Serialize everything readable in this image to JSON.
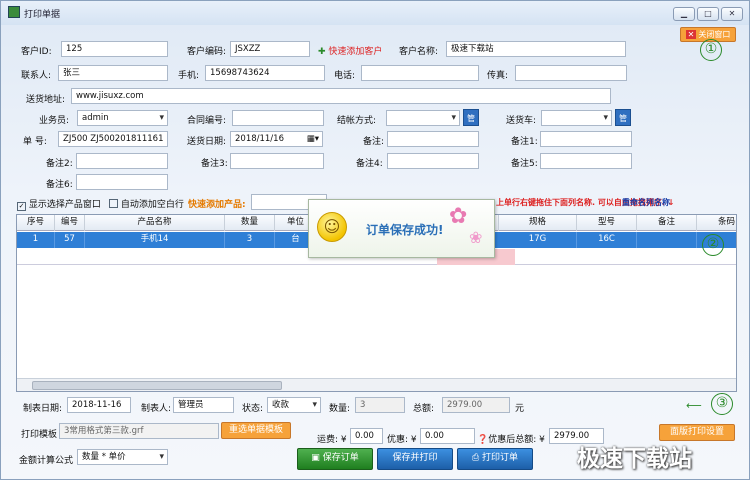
{
  "window": {
    "title": "打印单据",
    "min": "▁",
    "max": "□",
    "close": "✕"
  },
  "close_window_btn": "关闭窗口",
  "badges": [
    "①",
    "②",
    "③"
  ],
  "form": {
    "customer_id_label": "客户ID:",
    "customer_id": "125",
    "customer_code_label": "客户编码:",
    "customer_code": "JSXZZ",
    "quick_add_customer": "快速添加客户",
    "customer_name_label": "客户名称:",
    "customer_name": "极速下载站",
    "contact_label": "联系人:",
    "contact": "张三",
    "phone_label": "手机:",
    "phone": "15698743624",
    "tel_label": "电话:",
    "tel": "",
    "fax_label": "传真:",
    "fax": "",
    "address_label": "送货地址:",
    "address": "www.jisuxz.com",
    "salesman_label": "业务员:",
    "salesman": "admin",
    "contract_label": "合同编号:",
    "contract": "",
    "settlement_label": "结帐方式:",
    "settlement": "",
    "manage": "管",
    "vehicle_label": "送货车:",
    "vehicle": "",
    "order_no_label": "单  号:",
    "order_no": "ZJ500 ZJ500201811161",
    "delivery_date_label": "送货日期:",
    "delivery_date": "2018/11/16",
    "remark_label": "备注:",
    "remark1_label": "备注1:",
    "remark2_label": "备注2:",
    "remark3_label": "备注3:",
    "remark4_label": "备注4:",
    "remark5_label": "备注5:",
    "remark6_label": "备注6:"
  },
  "toolbar": {
    "show_product_window": "显示选择产品窗口",
    "auto_add_row": "自动添加空白行",
    "quick_add_product": "快速添加产品:",
    "hint": "上单行右键拖住下面列名称. 可以自由拖拽排序. ↓",
    "rename_columns": "重命名列名称"
  },
  "grid": {
    "columns": [
      "序号",
      "编号",
      "产品名称",
      "数量",
      "单位",
      "",
      "",
      "",
      "规格",
      "型号",
      "备注",
      "条码"
    ],
    "rows": [
      [
        "1",
        "57",
        "手机14",
        "3",
        "台",
        "",
        "",
        "",
        "17G",
        "16C",
        "",
        ""
      ]
    ]
  },
  "popup": {
    "text": "订单保存成功!"
  },
  "footer": {
    "make_date_label": "制表日期:",
    "make_date": "2018-11-16",
    "maker_label": "制表人:",
    "maker": "管理员",
    "status_label": "状态:",
    "status": "收款",
    "qty_label": "数量:",
    "qty": "3",
    "total_label": "总额:",
    "total": "2979.00",
    "unit": "元",
    "template_label": "打印模板",
    "template": "3常用格式第三款.grf",
    "choose_template": "重选单据模板",
    "freight_label": "运费: ¥",
    "freight": "0.00",
    "discount_label": "优惠: ¥",
    "discount": "0.00",
    "after_discount_label": "优惠后总额: ¥",
    "after_discount": "2979.00",
    "print_settings": "面版打印设置",
    "formula_label": "金额计算公式",
    "formula": "数量 * 单价",
    "save_order": "保存订单",
    "save_print": "保存并打印",
    "print_order": "打印订单"
  },
  "watermark": "极速下载站"
}
